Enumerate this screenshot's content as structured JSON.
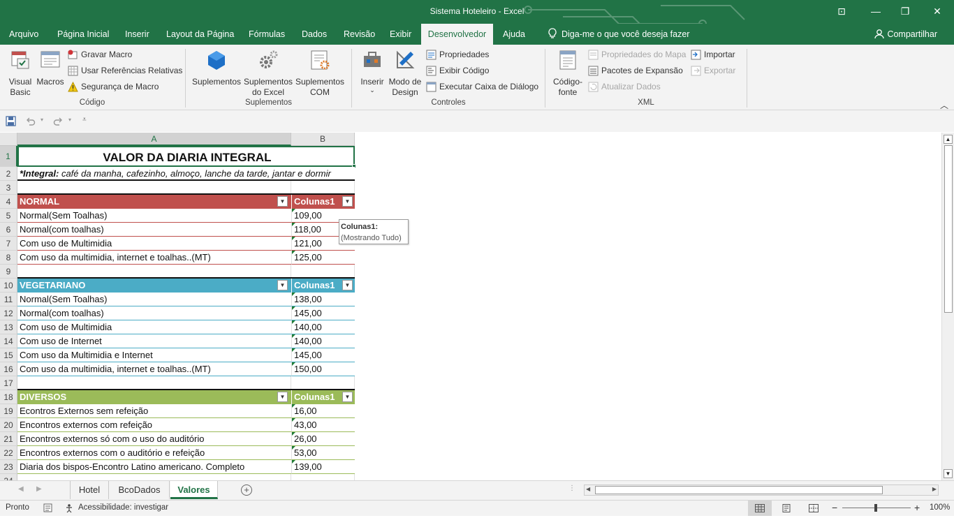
{
  "window": {
    "title": "Sistema Hoteleiro  -  Excel",
    "restore_glyph": "⊡",
    "min_glyph": "—",
    "max_glyph": "❐",
    "close_glyph": "✕"
  },
  "menu": {
    "tabs": [
      "Arquivo",
      "Página Inicial",
      "Inserir",
      "Layout da Página",
      "Fórmulas",
      "Dados",
      "Revisão",
      "Exibir",
      "Desenvolvedor",
      "Ajuda"
    ],
    "active_tab": "Desenvolvedor",
    "tell_me": "Diga-me o que você deseja fazer",
    "share": "Compartilhar"
  },
  "ribbon": {
    "codigo": {
      "label": "Código",
      "visual_basic": "Visual Basic",
      "visual_basic_l1": "Visual",
      "visual_basic_l2": "Basic",
      "macros": "Macros",
      "gravar_macro": "Gravar Macro",
      "usar_ref": "Usar Referências Relativas",
      "seguranca": "Segurança de Macro"
    },
    "suplementos": {
      "label": "Suplementos",
      "suplementos": "Suplementos",
      "excel_l1": "Suplementos",
      "excel_l2": "do Excel",
      "com_l1": "Suplementos",
      "com_l2": "COM"
    },
    "controles": {
      "label": "Controles",
      "inserir": "Inserir",
      "modo_l1": "Modo de",
      "modo_l2": "Design",
      "propriedades": "Propriedades",
      "exibir_codigo": "Exibir Código",
      "executar": "Executar Caixa de Diálogo"
    },
    "xml": {
      "label": "XML",
      "codigo_l1": "Código-",
      "codigo_l2": "fonte",
      "prop_mapa": "Propriedades do Mapa",
      "pacotes": "Pacotes de Expansão",
      "atualizar": "Atualizar Dados",
      "importar": "Importar",
      "exportar": "Exportar"
    }
  },
  "columns": [
    "A",
    "B"
  ],
  "title_cell": "VALOR DA DIARIA INTEGRAL",
  "note_bold": "*Integral:",
  "note_rest": " café da manha, cafezinho, almoço, lanche da tarde, jantar e dormir",
  "tables": [
    {
      "name": "NORMAL",
      "col2": "Colunas1",
      "color": "#c0504d",
      "row_start": 4,
      "rows": [
        [
          "Normal(Sem Toalhas)",
          "109,00"
        ],
        [
          "Normal(com toalhas)",
          "118,00"
        ],
        [
          "Com uso de Multimidia",
          "121,00"
        ],
        [
          "Com uso da multimidia, internet e toalhas..(MT)",
          "125,00"
        ]
      ]
    },
    {
      "name": "VEGETARIANO",
      "col2": "Colunas1",
      "color": "#4bacc6",
      "row_start": 10,
      "rows": [
        [
          "Normal(Sem Toalhas)",
          "138,00"
        ],
        [
          "Normal(com toalhas)",
          "145,00"
        ],
        [
          "Com uso de Multimidia",
          "140,00"
        ],
        [
          "Com uso de Internet",
          "140,00"
        ],
        [
          "Com uso da Multimidia e Internet",
          "145,00"
        ],
        [
          "Com uso da multimidia, internet e toalhas..(MT)",
          "150,00"
        ]
      ]
    },
    {
      "name": "DIVERSOS",
      "col2": "Colunas1",
      "color": "#9bbb59",
      "row_start": 18,
      "rows": [
        [
          "Econtros Externos sem refeição",
          "16,00"
        ],
        [
          "Encontros externos com refeição",
          "43,00"
        ],
        [
          "Encontros externos só com o uso do auditório",
          "26,00"
        ],
        [
          "Encontros externos com o auditório e refeição",
          "53,00"
        ],
        [
          "Diaria dos bispos-Encontro Latino americano. Completo",
          "139,00"
        ]
      ]
    }
  ],
  "tooltip": {
    "title": "Colunas1:",
    "text": "(Mostrando Tudo)"
  },
  "sheets": [
    "Hotel",
    "BcoDados",
    "Valores"
  ],
  "active_sheet": "Valores",
  "status": {
    "ready": "Pronto",
    "accessibility": "Acessibilidade: investigar",
    "zoom": "100%",
    "minus": "−",
    "plus": "+"
  }
}
